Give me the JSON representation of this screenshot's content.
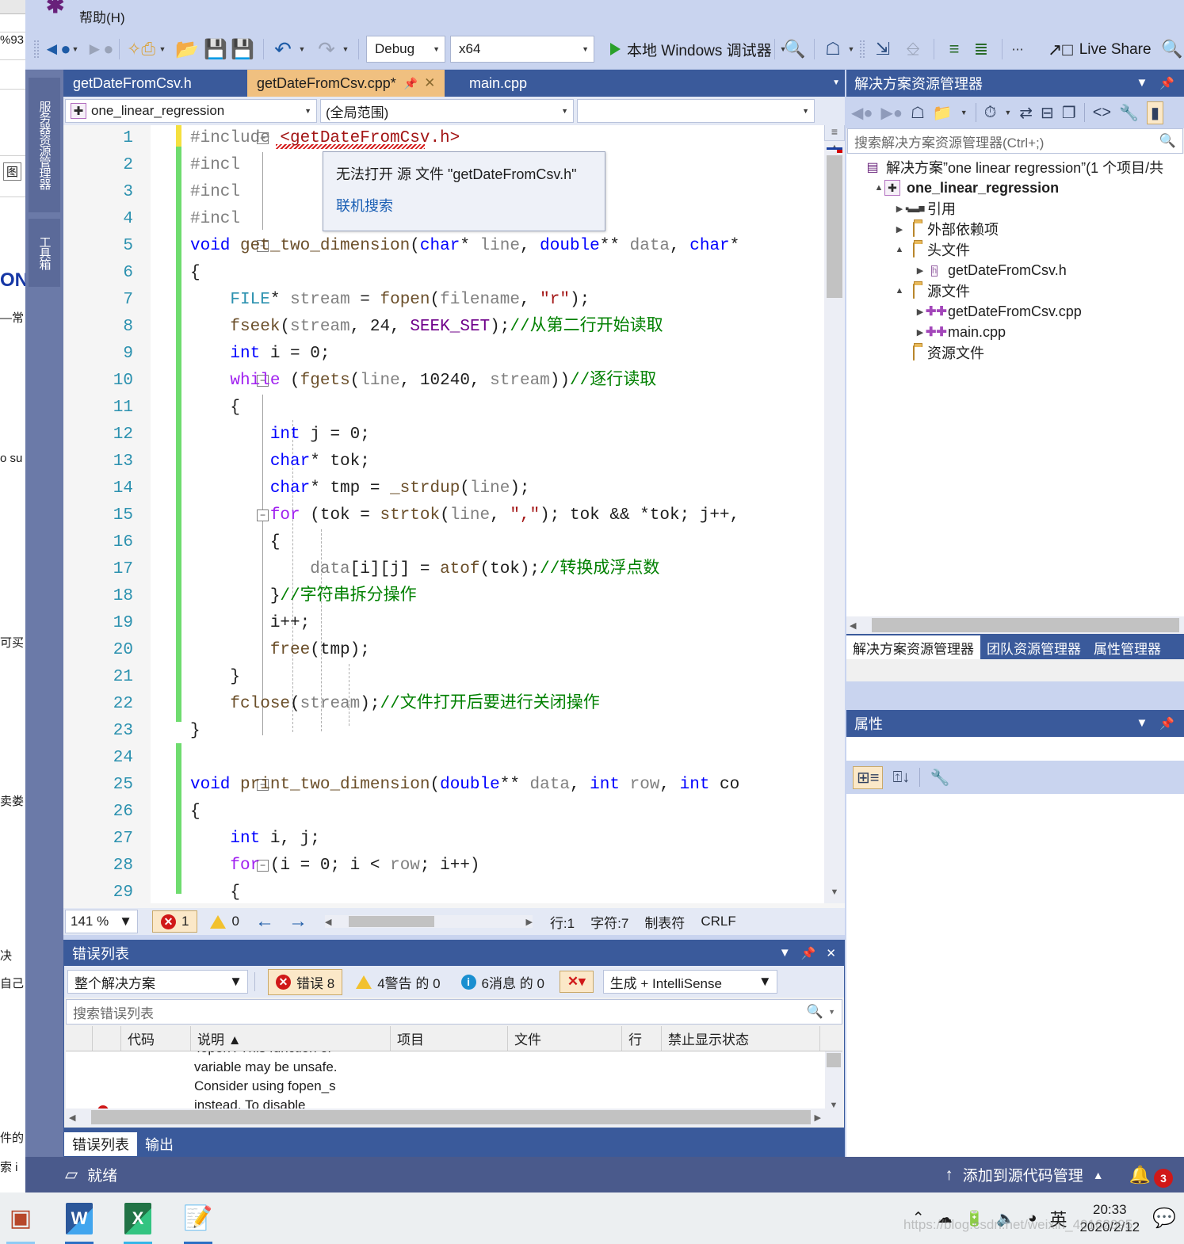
{
  "background_docs": {
    "cells": [
      "%93",
      "图",
      "ON",
      "—常",
      "o su",
      "可买",
      "卖娄",
      "决",
      "自己",
      "件的",
      "索 i"
    ]
  },
  "vs": {
    "menu": {
      "help": "帮助(H)"
    },
    "toolbar": {
      "back_icon": "back-arrow-icon",
      "forward_icon": "forward-arrow-icon",
      "new_item_icon": "new-item-icon",
      "open_file_icon": "open-folder-icon",
      "save_icon": "save-icon",
      "save_all_icon": "save-all-icon",
      "undo_icon": "undo-icon",
      "redo_icon": "redo-icon",
      "config": "Debug",
      "platform": "x64",
      "run_label": "本地 Windows 调试器",
      "live_share": "Live Share",
      "live_share_icon": "share-icon",
      "search_icon": "search-icon",
      "find_icon": "find-icon",
      "home_icon": "home-icon"
    },
    "dock_tabs": [
      "服务器资源管理器",
      "工具箱"
    ],
    "document_tabs": [
      {
        "label": "getDateFromCsv.h",
        "active": false,
        "dirty": false
      },
      {
        "label": "getDateFromCsv.cpp*",
        "active": true,
        "dirty": true
      },
      {
        "label": "main.cpp",
        "active": false,
        "dirty": false
      }
    ],
    "nav_bar": {
      "project": "one_linear_regression",
      "scope": "(全局范围)"
    },
    "tooltip": {
      "message": "无法打开 源 文件 \"getDateFromCsv.h\"",
      "link": "联机搜索"
    },
    "editor_status": {
      "zoom": "141 %",
      "errors": "1",
      "warnings": "0",
      "line_label": "行:1",
      "char_label": "字符:7",
      "tab_label": "制表符",
      "eol": "CRLF"
    },
    "status_bar": {
      "ready": "就绪",
      "source_control": "添加到源代码管理",
      "notifications": "3"
    }
  },
  "code": {
    "lines": [
      {
        "n": "1",
        "tokens": [
          {
            "t": "#include ",
            "c": "pp"
          },
          {
            "t": "<getDateFromCsv.h>",
            "c": "str-red"
          }
        ]
      },
      {
        "n": "2",
        "tokens": [
          {
            "t": "#incl",
            "c": "pp"
          }
        ]
      },
      {
        "n": "3",
        "tokens": [
          {
            "t": "#incl",
            "c": "pp"
          }
        ]
      },
      {
        "n": "4",
        "tokens": [
          {
            "t": "#incl",
            "c": "pp"
          }
        ]
      },
      {
        "n": "5",
        "tokens": [
          {
            "t": "void",
            "c": "k"
          },
          {
            "t": " ",
            "c": "nm"
          },
          {
            "t": "get_two_dimension",
            "c": "fn"
          },
          {
            "t": "(",
            "c": "nm"
          },
          {
            "t": "char",
            "c": "k"
          },
          {
            "t": "* ",
            "c": "nm"
          },
          {
            "t": "line",
            "c": "id"
          },
          {
            "t": ", ",
            "c": "nm"
          },
          {
            "t": "double",
            "c": "k"
          },
          {
            "t": "** ",
            "c": "nm"
          },
          {
            "t": "data",
            "c": "id"
          },
          {
            "t": ", ",
            "c": "nm"
          },
          {
            "t": "char",
            "c": "k"
          },
          {
            "t": "*",
            "c": "nm"
          }
        ]
      },
      {
        "n": "6",
        "tokens": [
          {
            "t": "{",
            "c": "nm"
          }
        ]
      },
      {
        "n": "7",
        "tokens": [
          {
            "t": "    ",
            "c": "nm"
          },
          {
            "t": "FILE",
            "c": "ty"
          },
          {
            "t": "* ",
            "c": "nm"
          },
          {
            "t": "stream",
            "c": "id"
          },
          {
            "t": " = ",
            "c": "nm"
          },
          {
            "t": "fopen",
            "c": "fn"
          },
          {
            "t": "(",
            "c": "nm"
          },
          {
            "t": "filename",
            "c": "id"
          },
          {
            "t": ", ",
            "c": "nm"
          },
          {
            "t": "\"r\"",
            "c": "st"
          },
          {
            "t": ");",
            "c": "nm"
          }
        ]
      },
      {
        "n": "8",
        "tokens": [
          {
            "t": "    ",
            "c": "nm"
          },
          {
            "t": "fseek",
            "c": "fn"
          },
          {
            "t": "(",
            "c": "nm"
          },
          {
            "t": "stream",
            "c": "id"
          },
          {
            "t": ", ",
            "c": "nm"
          },
          {
            "t": "24",
            "c": "nm"
          },
          {
            "t": ", ",
            "c": "nm"
          },
          {
            "t": "SEEK_SET",
            "c": "mc"
          },
          {
            "t": ");",
            "c": "nm"
          },
          {
            "t": "//从第二行开始读取",
            "c": "cm"
          }
        ]
      },
      {
        "n": "9",
        "tokens": [
          {
            "t": "    ",
            "c": "nm"
          },
          {
            "t": "int",
            "c": "k"
          },
          {
            "t": " i = ",
            "c": "nm"
          },
          {
            "t": "0",
            "c": "nm"
          },
          {
            "t": ";",
            "c": "nm"
          }
        ]
      },
      {
        "n": "10",
        "tokens": [
          {
            "t": "    ",
            "c": "nm"
          },
          {
            "t": "while",
            "c": "kw"
          },
          {
            "t": " (",
            "c": "nm"
          },
          {
            "t": "fgets",
            "c": "fn"
          },
          {
            "t": "(",
            "c": "nm"
          },
          {
            "t": "line",
            "c": "id"
          },
          {
            "t": ", ",
            "c": "nm"
          },
          {
            "t": "10240",
            "c": "nm"
          },
          {
            "t": ", ",
            "c": "nm"
          },
          {
            "t": "stream",
            "c": "id"
          },
          {
            "t": "))",
            "c": "nm"
          },
          {
            "t": "//逐行读取",
            "c": "cm"
          }
        ]
      },
      {
        "n": "11",
        "tokens": [
          {
            "t": "    {",
            "c": "nm"
          }
        ]
      },
      {
        "n": "12",
        "tokens": [
          {
            "t": "        ",
            "c": "nm"
          },
          {
            "t": "int",
            "c": "k"
          },
          {
            "t": " j = ",
            "c": "nm"
          },
          {
            "t": "0",
            "c": "nm"
          },
          {
            "t": ";",
            "c": "nm"
          }
        ]
      },
      {
        "n": "13",
        "tokens": [
          {
            "t": "        ",
            "c": "nm"
          },
          {
            "t": "char",
            "c": "k"
          },
          {
            "t": "* tok;",
            "c": "nm"
          }
        ]
      },
      {
        "n": "14",
        "tokens": [
          {
            "t": "        ",
            "c": "nm"
          },
          {
            "t": "char",
            "c": "k"
          },
          {
            "t": "* tmp = ",
            "c": "nm"
          },
          {
            "t": "_strdup",
            "c": "fn"
          },
          {
            "t": "(",
            "c": "nm"
          },
          {
            "t": "line",
            "c": "id"
          },
          {
            "t": ");",
            "c": "nm"
          }
        ]
      },
      {
        "n": "15",
        "tokens": [
          {
            "t": "        ",
            "c": "nm"
          },
          {
            "t": "for",
            "c": "kw"
          },
          {
            "t": " (tok = ",
            "c": "nm"
          },
          {
            "t": "strtok",
            "c": "fn"
          },
          {
            "t": "(",
            "c": "nm"
          },
          {
            "t": "line",
            "c": "id"
          },
          {
            "t": ", ",
            "c": "nm"
          },
          {
            "t": "\",\"",
            "c": "st"
          },
          {
            "t": "); tok && *tok; j++,",
            "c": "nm"
          }
        ]
      },
      {
        "n": "16",
        "tokens": [
          {
            "t": "        {",
            "c": "nm"
          }
        ]
      },
      {
        "n": "17",
        "tokens": [
          {
            "t": "            ",
            "c": "nm"
          },
          {
            "t": "data",
            "c": "id"
          },
          {
            "t": "[i][j] = ",
            "c": "nm"
          },
          {
            "t": "atof",
            "c": "fn"
          },
          {
            "t": "(tok);",
            "c": "nm"
          },
          {
            "t": "//转换成浮点数",
            "c": "cm"
          }
        ]
      },
      {
        "n": "18",
        "tokens": [
          {
            "t": "        }",
            "c": "nm"
          },
          {
            "t": "//字符串拆分操作",
            "c": "cm"
          }
        ]
      },
      {
        "n": "19",
        "tokens": [
          {
            "t": "        i++;",
            "c": "nm"
          }
        ]
      },
      {
        "n": "20",
        "tokens": [
          {
            "t": "        ",
            "c": "nm"
          },
          {
            "t": "free",
            "c": "fn"
          },
          {
            "t": "(tmp);",
            "c": "nm"
          }
        ]
      },
      {
        "n": "21",
        "tokens": [
          {
            "t": "    }",
            "c": "nm"
          }
        ]
      },
      {
        "n": "22",
        "tokens": [
          {
            "t": "    ",
            "c": "nm"
          },
          {
            "t": "fclose",
            "c": "fn"
          },
          {
            "t": "(",
            "c": "nm"
          },
          {
            "t": "stream",
            "c": "id"
          },
          {
            "t": ");",
            "c": "nm"
          },
          {
            "t": "//文件打开后要进行关闭操作",
            "c": "cm"
          }
        ]
      },
      {
        "n": "23",
        "tokens": [
          {
            "t": "}",
            "c": "nm"
          }
        ]
      },
      {
        "n": "24",
        "tokens": [
          {
            "t": "",
            "c": "nm"
          }
        ]
      },
      {
        "n": "25",
        "tokens": [
          {
            "t": "void",
            "c": "k"
          },
          {
            "t": " ",
            "c": "nm"
          },
          {
            "t": "print_two_dimension",
            "c": "fn"
          },
          {
            "t": "(",
            "c": "nm"
          },
          {
            "t": "double",
            "c": "k"
          },
          {
            "t": "** ",
            "c": "nm"
          },
          {
            "t": "data",
            "c": "id"
          },
          {
            "t": ", ",
            "c": "nm"
          },
          {
            "t": "int",
            "c": "k"
          },
          {
            "t": " ",
            "c": "nm"
          },
          {
            "t": "row",
            "c": "id"
          },
          {
            "t": ", ",
            "c": "nm"
          },
          {
            "t": "int",
            "c": "k"
          },
          {
            "t": " co",
            "c": "nm"
          }
        ]
      },
      {
        "n": "26",
        "tokens": [
          {
            "t": "{",
            "c": "nm"
          }
        ]
      },
      {
        "n": "27",
        "tokens": [
          {
            "t": "    ",
            "c": "nm"
          },
          {
            "t": "int",
            "c": "k"
          },
          {
            "t": " i, j;",
            "c": "nm"
          }
        ]
      },
      {
        "n": "28",
        "tokens": [
          {
            "t": "    ",
            "c": "nm"
          },
          {
            "t": "for",
            "c": "kw"
          },
          {
            "t": " (i = ",
            "c": "nm"
          },
          {
            "t": "0",
            "c": "nm"
          },
          {
            "t": "; i < ",
            "c": "nm"
          },
          {
            "t": "row",
            "c": "id"
          },
          {
            "t": "; i++)",
            "c": "nm"
          }
        ]
      },
      {
        "n": "29",
        "tokens": [
          {
            "t": "    {",
            "c": "nm"
          }
        ]
      }
    ]
  },
  "solution_explorer": {
    "title": "解决方案资源管理器",
    "search_placeholder": "搜索解决方案资源管理器(Ctrl+;)",
    "toolbar_icons": [
      "back-arrow-icon",
      "forward-arrow-icon",
      "home-icon",
      "sync-with-document-icon",
      "pending-changes-icon",
      "refresh-icon",
      "collapse-all-icon",
      "show-all-files-icon",
      "view-code-icon",
      "properties-wrench-icon",
      "preview-icon"
    ],
    "tree": [
      {
        "indent": 0,
        "expander": "",
        "icon": "solution-icon",
        "label": "解决方案”one linear regression”(1 个项目/共",
        "bold": false
      },
      {
        "indent": 1,
        "expander": "▲",
        "icon": "project-icon",
        "label": "one_linear_regression",
        "bold": true
      },
      {
        "indent": 2,
        "expander": "▶",
        "icon": "references-icon",
        "label": "引用",
        "bold": false
      },
      {
        "indent": 2,
        "expander": "▶",
        "icon": "external-deps-icon",
        "label": "外部依赖项",
        "bold": false
      },
      {
        "indent": 2,
        "expander": "▲",
        "icon": "folder-filter-icon",
        "label": "头文件",
        "bold": false
      },
      {
        "indent": 3,
        "expander": "▶",
        "icon": "header-file-icon",
        "label": "getDateFromCsv.h",
        "bold": false
      },
      {
        "indent": 2,
        "expander": "▲",
        "icon": "folder-filter-icon",
        "label": "源文件",
        "bold": false
      },
      {
        "indent": 3,
        "expander": "▶",
        "icon": "cpp-file-icon",
        "label": "getDateFromCsv.cpp",
        "bold": false
      },
      {
        "indent": 3,
        "expander": "▶",
        "icon": "cpp-file-icon",
        "label": "main.cpp",
        "bold": false
      },
      {
        "indent": 2,
        "expander": "",
        "icon": "folder-filter-icon",
        "label": "资源文件",
        "bold": false
      }
    ],
    "tabs": [
      {
        "label": "解决方案资源管理器",
        "active": true
      },
      {
        "label": "团队资源管理器",
        "active": false
      },
      {
        "label": "属性管理器",
        "active": false
      }
    ]
  },
  "properties": {
    "title": "属性",
    "toolbar_icons": [
      "categorized-icon",
      "alphabetical-icon",
      "property-pages-wrench-icon"
    ]
  },
  "error_list": {
    "title": "错误列表",
    "scope": "整个解决方案",
    "errors_label": "错误 8",
    "warnings_label": "4警告 的 0",
    "messages_label": "6消息 的 0",
    "filter_icon": "clear-filter-icon",
    "build_filter": "生成 + IntelliSense",
    "search_placeholder": "搜索错误列表",
    "columns": [
      "",
      "",
      "代码",
      "说明 ▲",
      "项目",
      "文件",
      "行",
      "禁止显示状态"
    ],
    "row_text": [
      "'fopen': This function or",
      "variable may be unsafe.",
      "Consider using fopen_s",
      "instead. To disable"
    ],
    "tabs": [
      {
        "label": "错误列表",
        "active": true
      },
      {
        "label": "输出",
        "active": false
      }
    ]
  },
  "taskbar": {
    "icons": [
      "powerpoint-icon",
      "word-icon",
      "excel-icon",
      "notepad-editor-icon"
    ],
    "tray_icons": [
      "chevron-up-icon",
      "onedrive-icon",
      "battery-icon",
      "volume-icon",
      "wifi-icon"
    ],
    "ime": "英",
    "time": "20:33",
    "date": "2020/2/12",
    "action_center_icon": "action-center-icon"
  },
  "watermark": "https://blog.csdn.net/weixin_40162095"
}
